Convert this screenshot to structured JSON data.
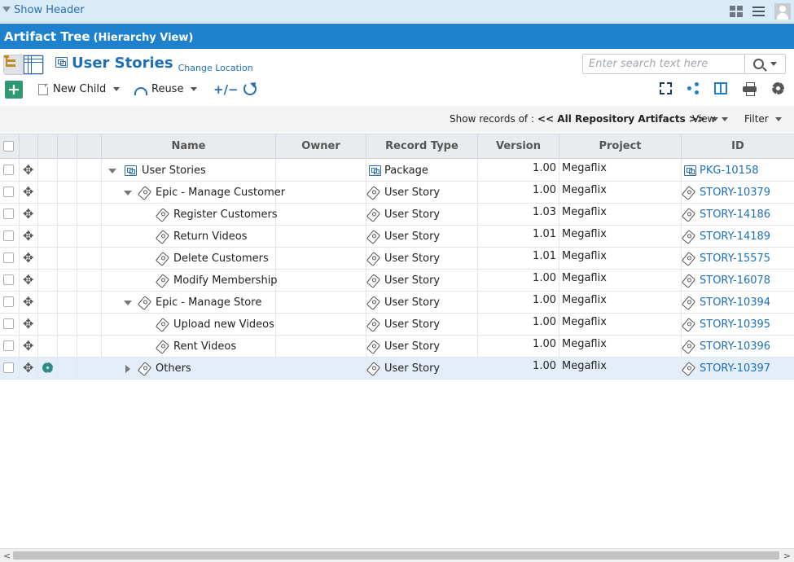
{
  "header": {
    "show_header": "Show Header"
  },
  "titlebar": {
    "title": "Artifact Tree",
    "subtitle": "(Hierarchy View)"
  },
  "page": {
    "title": "User Stories",
    "change_location": "Change Location"
  },
  "search": {
    "placeholder": "Enter search text here"
  },
  "toolbar": {
    "add": "+",
    "new_child": "New Child",
    "reuse": "Reuse",
    "plusminus": "+/−"
  },
  "filterbar": {
    "show_records_label": "Show records of :",
    "show_records_value": "<< All Repository Artifacts >>",
    "view": "View",
    "filter": "Filter"
  },
  "columns": {
    "name": "Name",
    "owner": "Owner",
    "record_type": "Record Type",
    "version": "Version",
    "project": "Project",
    "id": "ID"
  },
  "rows": [
    {
      "name": "User Stories",
      "record_type": "Package",
      "version": "1.00",
      "project": "Megaflix",
      "id": "PKG-10158"
    },
    {
      "name": "Epic - Manage Customer",
      "record_type": "User Story",
      "version": "1.00",
      "project": "Megaflix",
      "id": "STORY-10379"
    },
    {
      "name": "Register Customers",
      "record_type": "User Story",
      "version": "1.03",
      "project": "Megaflix",
      "id": "STORY-14186"
    },
    {
      "name": "Return Videos",
      "record_type": "User Story",
      "version": "1.01",
      "project": "Megaflix",
      "id": "STORY-14189"
    },
    {
      "name": "Delete Customers",
      "record_type": "User Story",
      "version": "1.01",
      "project": "Megaflix",
      "id": "STORY-15575"
    },
    {
      "name": "Modify Membership",
      "record_type": "User Story",
      "version": "1.00",
      "project": "Megaflix",
      "id": "STORY-16078"
    },
    {
      "name": "Epic - Manage Store",
      "record_type": "User Story",
      "version": "1.00",
      "project": "Megaflix",
      "id": "STORY-10394"
    },
    {
      "name": "Upload new Videos",
      "record_type": "User Story",
      "version": "1.00",
      "project": "Megaflix",
      "id": "STORY-10395"
    },
    {
      "name": "Rent Videos",
      "record_type": "User Story",
      "version": "1.00",
      "project": "Megaflix",
      "id": "STORY-10396"
    },
    {
      "name": "Others",
      "record_type": "User Story",
      "version": "1.00",
      "project": "Megaflix",
      "id": "STORY-10397"
    }
  ]
}
